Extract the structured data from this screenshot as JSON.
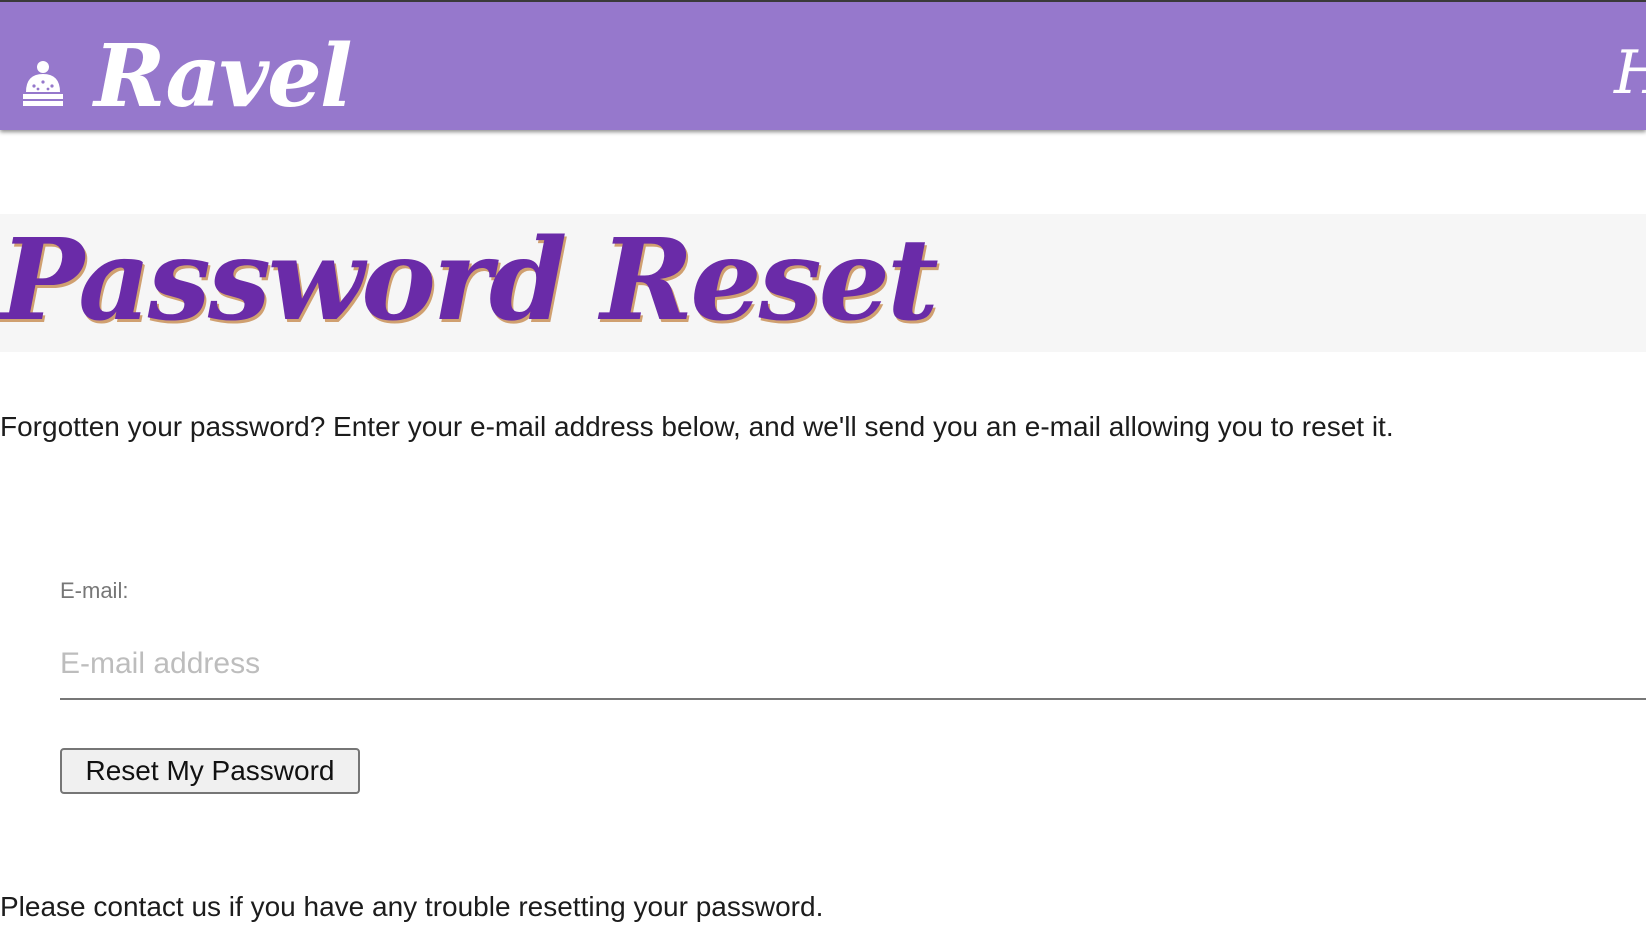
{
  "header": {
    "brand_name": "Ravel",
    "brand_icon": "winter-hat-icon",
    "edge_glyph": "H",
    "background_color": "#9678cc"
  },
  "page": {
    "title": "Password Reset",
    "title_color": "#6a2ba8",
    "intro": "Forgotten your password? Enter your e-mail address below, and we'll send you an e-mail allowing you to reset it."
  },
  "form": {
    "email_label": "E-mail:",
    "email_placeholder": "E-mail address",
    "email_value": "",
    "submit_label": "Reset My Password"
  },
  "footer": {
    "note": "Please contact us if you have any trouble resetting your password."
  }
}
